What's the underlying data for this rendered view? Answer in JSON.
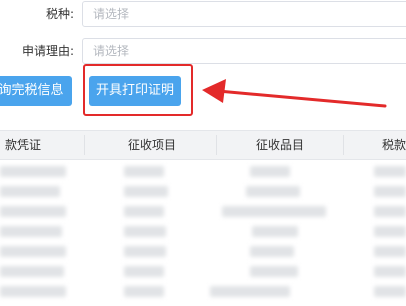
{
  "form": {
    "tax_type": {
      "label": "税种:",
      "placeholder": "请选择"
    },
    "reason": {
      "label": "申请理由:",
      "placeholder": "请选择"
    }
  },
  "toolbar": {
    "query_label": "询完税信息",
    "print_label": "开具打印证明"
  },
  "colors": {
    "primary": "#4aa4ed",
    "highlight": "#e32a2a",
    "header_bg": "#f2f3f5"
  },
  "table": {
    "columns": [
      "款凭证",
      "征收项目",
      "征收品目",
      "税款所"
    ],
    "rows_note": "blurred"
  }
}
